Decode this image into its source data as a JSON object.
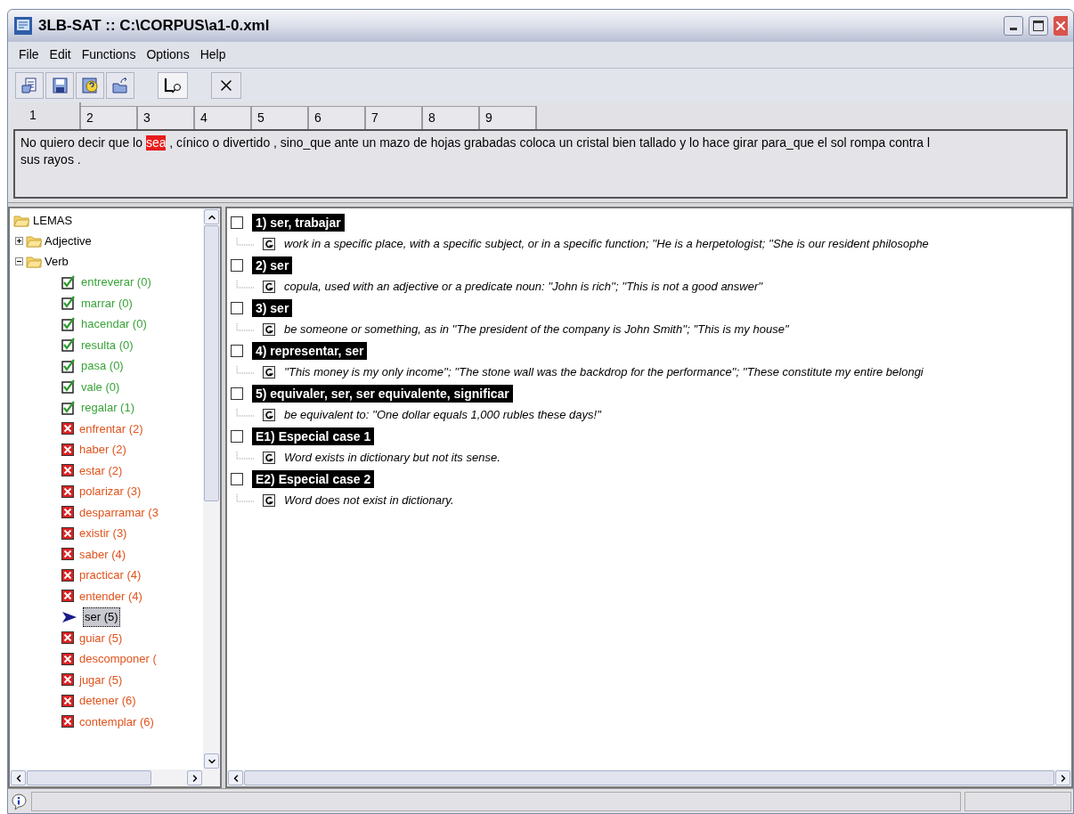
{
  "window": {
    "title": "3LB-SAT :: C:\\CORPUS\\a1-0.xml"
  },
  "menu": [
    "File",
    "Edit",
    "Functions",
    "Options",
    "Help"
  ],
  "tabs": [
    {
      "label": "1",
      "selected": true
    },
    {
      "label": "2",
      "selected": false
    },
    {
      "label": "3",
      "selected": false
    },
    {
      "label": "4",
      "selected": false
    },
    {
      "label": "5",
      "selected": false
    },
    {
      "label": "6",
      "selected": false
    },
    {
      "label": "7",
      "selected": false
    },
    {
      "label": "8",
      "selected": false
    },
    {
      "label": "9",
      "selected": false
    }
  ],
  "sentence": {
    "lines": [
      [
        {
          "text": "No quiero decir que lo ",
          "highlighted": false
        },
        {
          "text": "sea",
          "highlighted": true
        },
        {
          "text": " , cínico o divertido , sino_que ante un mazo de hojas grabadas coloca un cristal bien tallado y lo hace girar para_que el sol rompa contra l",
          "highlighted": false
        }
      ],
      [
        {
          "text": "sus rayos .",
          "highlighted": false
        }
      ]
    ]
  },
  "tree": {
    "label": "LEMAS",
    "children": [
      {
        "label": "Adjective",
        "expanded": false
      },
      {
        "label": "Verb",
        "expanded": true,
        "children": [
          {
            "label": "entreverar (0)",
            "kind": "done",
            "selected": false
          },
          {
            "label": "marrar (0)",
            "kind": "done",
            "selected": false
          },
          {
            "label": "hacendar (0)",
            "kind": "done",
            "selected": false
          },
          {
            "label": "resulta (0)",
            "kind": "done",
            "selected": false
          },
          {
            "label": "pasa (0)",
            "kind": "done",
            "selected": false
          },
          {
            "label": "vale (0)",
            "kind": "done",
            "selected": false
          },
          {
            "label": "regalar (1)",
            "kind": "done",
            "selected": false
          },
          {
            "label": "enfrentar (2)",
            "kind": "pending",
            "selected": false
          },
          {
            "label": "haber (2)",
            "kind": "pending",
            "selected": false
          },
          {
            "label": "estar (2)",
            "kind": "pending",
            "selected": false
          },
          {
            "label": "polarizar (3)",
            "kind": "pending",
            "selected": false
          },
          {
            "label": "desparramar (3",
            "kind": "pending",
            "selected": false
          },
          {
            "label": "existir (3)",
            "kind": "pending",
            "selected": false
          },
          {
            "label": "saber (4)",
            "kind": "pending",
            "selected": false
          },
          {
            "label": "practicar (4)",
            "kind": "pending",
            "selected": false
          },
          {
            "label": "entender (4)",
            "kind": "pending",
            "selected": false
          },
          {
            "label": "ser (5)",
            "kind": "current",
            "selected": true
          },
          {
            "label": "guiar (5)",
            "kind": "pending",
            "selected": false
          },
          {
            "label": "descomponer (",
            "kind": "pending",
            "selected": false
          },
          {
            "label": "jugar (5)",
            "kind": "pending",
            "selected": false
          },
          {
            "label": "detener (6)",
            "kind": "pending",
            "selected": false
          },
          {
            "label": "contemplar (6)",
            "kind": "pending",
            "selected": false
          }
        ]
      }
    ]
  },
  "senses": [
    {
      "label": "1) ser, trabajar",
      "checked": false,
      "gloss": "work in a specific place, with a specific subject, or in a specific function; ''He is a herpetologist; ''She is our resident philosophe"
    },
    {
      "label": "2) ser",
      "checked": false,
      "gloss": "copula, used with an adjective or a predicate noun: ''John is rich''; ''This is not a good answer''"
    },
    {
      "label": "3) ser",
      "checked": false,
      "gloss": "be someone or something, as in ''The president of the company is John Smith''; ''This is my house''"
    },
    {
      "label": "4) representar, ser",
      "checked": false,
      "gloss": "''This money is my only income''; ''The stone wall was the backdrop for the performance''; ''These constitute my entire belongi"
    },
    {
      "label": "5) equivaler, ser, ser equivalente, significar",
      "checked": false,
      "gloss": "be equivalent to: ''One dollar equals 1,000 rubles these days!''"
    },
    {
      "label": "E1) Especial case 1",
      "checked": false,
      "gloss": "Word exists in dictionary but not its sense."
    },
    {
      "label": "E2) Especial case 2",
      "checked": false,
      "gloss": "Word does not exist in dictionary."
    }
  ]
}
